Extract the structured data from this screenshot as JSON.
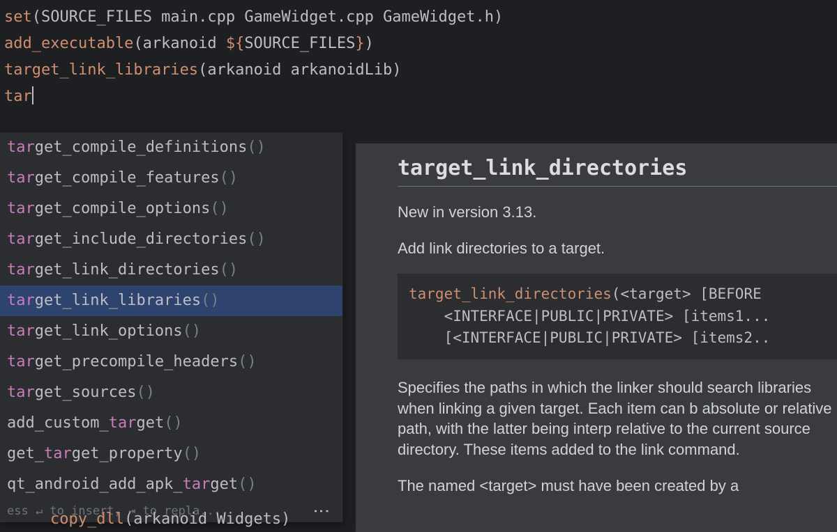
{
  "code": {
    "l1_kw": "set",
    "l1_rest": "(SOURCE_FILES main.cpp GameWidget.cpp GameWidget.h)",
    "l2_kw": "add_executable",
    "l2_open": "(arkanoid ",
    "l2_vb_open": "${",
    "l2_var": "SOURCE_FILES",
    "l2_vb_close": "}",
    "l2_close": ")",
    "l3_kw": "target_link_libraries",
    "l3_rest": "(arkanoid arkanoidLib)",
    "typed": "tar"
  },
  "completions": [
    {
      "pre": "tar",
      "rest": "get_compile_definitions",
      "suffix": "()"
    },
    {
      "pre": "tar",
      "rest": "get_compile_features",
      "suffix": "()"
    },
    {
      "pre": "tar",
      "rest": "get_compile_options",
      "suffix": "()"
    },
    {
      "pre": "tar",
      "rest": "get_include_directories",
      "suffix": "()"
    },
    {
      "pre": "tar",
      "rest": "get_link_directories",
      "suffix": "()"
    },
    {
      "pre": "tar",
      "rest": "get_link_libraries",
      "suffix": "()",
      "selected": true
    },
    {
      "pre": "tar",
      "rest": "get_link_options",
      "suffix": "()"
    },
    {
      "pre": "tar",
      "rest": "get_precompile_headers",
      "suffix": "()"
    },
    {
      "pre": "tar",
      "rest": "get_sources",
      "suffix": "()"
    },
    {
      "pre": "",
      "rest": "add_custom_",
      "mid": "tar",
      "rest2": "get",
      "suffix": "()"
    },
    {
      "pre": "",
      "rest": "get_",
      "mid": "tar",
      "rest2": "get_property",
      "suffix": "()"
    },
    {
      "pre": "",
      "rest": "qt_android_add_apk_",
      "mid": "tar",
      "rest2": "get",
      "suffix": "()"
    }
  ],
  "popup_hint": "ess ↵ to insert, ⇥ to repla...",
  "doc": {
    "title": "target_link_directories",
    "version": "New in version 3.13.",
    "subtitle": "Add link directories to a target.",
    "signature_fn": "target_link_directories",
    "signature_rest1": "(<target> [BEFORE",
    "signature_line2": "    <INTERFACE|PUBLIC|PRIVATE> [items1...",
    "signature_line3": "    [<INTERFACE|PUBLIC|PRIVATE> [items2..",
    "body1": "Specifies the paths in which the linker should search libraries when linking a given target. Each item can b absolute or relative path, with the latter being interp relative to the current source directory. These items added to the link command.",
    "body2": "The named <target> must have been created by a"
  },
  "bottom": {
    "fn": "copy_dll",
    "rest": "(arkanoid Widgets)"
  }
}
